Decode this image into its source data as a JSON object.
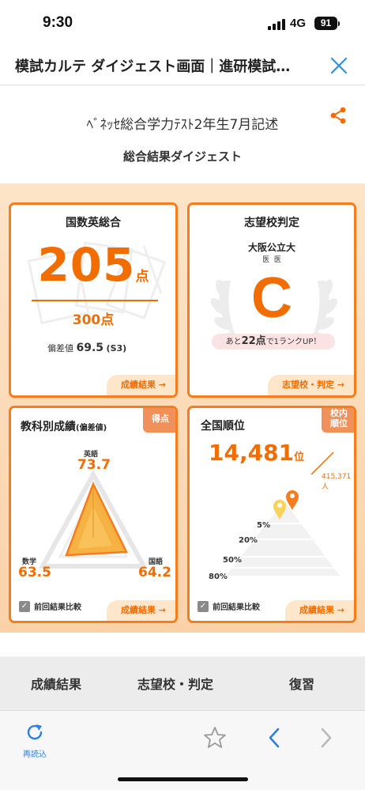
{
  "status": {
    "time": "9:30",
    "network": "4G",
    "battery": "91"
  },
  "header": {
    "title": "模試カルテ ダイジェスト画面｜進研模試…"
  },
  "page": {
    "exam_name": "ﾍﾞﾈｯｾ総合学力ﾃｽﾄ2年生7月記述",
    "digest_title": "総合結果ダイジェスト"
  },
  "cards": {
    "total": {
      "title": "国数英総合",
      "score": "205",
      "score_unit": "点",
      "max": "300点",
      "dev_label": "偏差値",
      "dev_value": "69.5",
      "dev_note": "(S3)",
      "link": "成績結果 →"
    },
    "target": {
      "title": "志望校判定",
      "school": "大阪公立大",
      "dept1": "医",
      "dept2": "医",
      "grade": "C",
      "pill_pre": "あと",
      "pill_num": "22点",
      "pill_post": "で1ランクUP！",
      "link": "志望校・判定 →"
    },
    "subjects": {
      "title": "教科別成績",
      "title_note": "(偏差値)",
      "tag": "得点",
      "english_label": "英語",
      "english_value": "73.7",
      "math_label": "数学",
      "math_value": "63.5",
      "japanese_label": "国語",
      "japanese_value": "64.2",
      "compare": "前回結果比較",
      "link": "成績結果 →"
    },
    "rank": {
      "title": "全国順位",
      "tag_line1": "校内",
      "tag_line2": "順位",
      "rank_value": "14,481",
      "rank_unit": "位",
      "total": "415,371人",
      "levels": [
        "5%",
        "20%",
        "50%",
        "80%"
      ],
      "compare": "前回結果比較",
      "link": "成績結果 →"
    }
  },
  "bottom_tabs": [
    "成績結果",
    "志望校・判定",
    "復習"
  ],
  "browser": {
    "reload_label": "再読込"
  },
  "colors": {
    "accent": "#f26d00",
    "card_border": "#f57c1f",
    "link_bg": "#fde6c9",
    "browser_blue": "#2f7fe0"
  }
}
